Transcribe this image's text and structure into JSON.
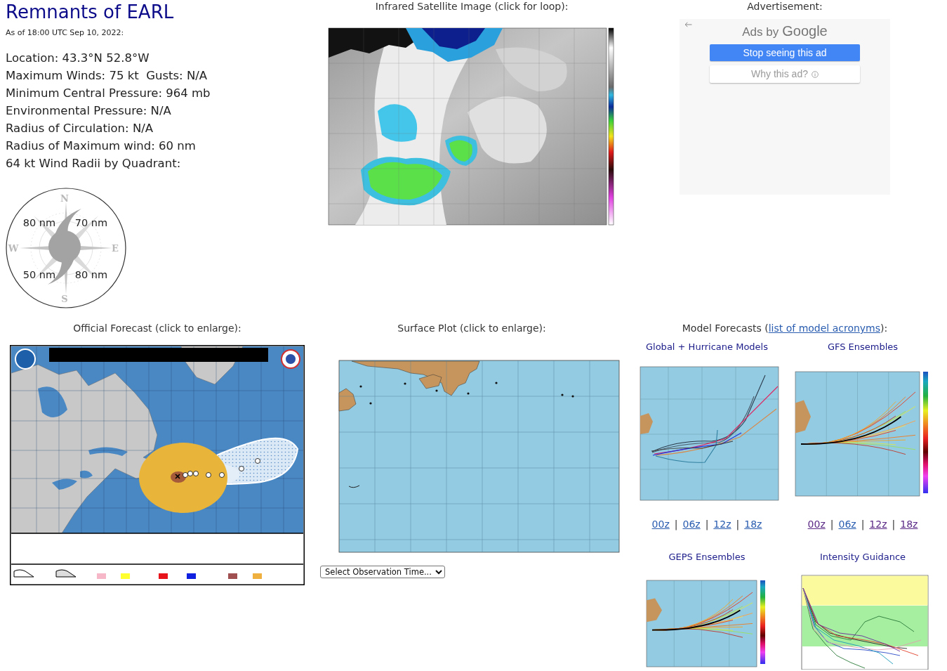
{
  "storm": {
    "title": "Remnants of EARL",
    "as_of": "As of 18:00 UTC Sep 10, 2022:",
    "details": [
      "Location: 43.3°N 52.8°W",
      "Maximum Winds: 75 kt  Gusts: N/A",
      "Minimum Central Pressure: 964 mb",
      "Environmental Pressure: N/A",
      "Radius of Circulation: N/A",
      "Radius of Maximum wind: 60 nm",
      "64 kt Wind Radii by Quadrant:"
    ]
  },
  "wind_radii": {
    "directions": [
      "N",
      "W",
      "E",
      "S"
    ],
    "quadrants": [
      "80 nm",
      "70 nm",
      "50 nm",
      "80 nm"
    ]
  },
  "satellite": {
    "caption": "Infrared Satellite Image (click for loop):"
  },
  "advertisement": {
    "caption": "Advertisement:",
    "label": "Ads by",
    "brand": "Google",
    "buttons": [
      {
        "label": "Stop seeing this ad",
        "kind": "primary"
      },
      {
        "label": "Why this ad?",
        "kind": "info"
      }
    ]
  },
  "official_forecast": {
    "caption": "Official Forecast (click to enlarge):"
  },
  "surface_plot": {
    "caption": "Surface Plot (click to enlarge):",
    "select": {
      "value": "Select Observation Time..."
    }
  },
  "model_forecasts": {
    "caption": "Model Forecasts (",
    "link": "list of model acronyms",
    "caption_end": "):",
    "separator": "|",
    "panels": [
      {
        "title": "Global + Hurricane Models",
        "kind": "tracks",
        "runs": [
          {
            "label": "00z",
            "visited": false
          },
          {
            "label": "06z",
            "visited": false
          },
          {
            "label": "12z",
            "visited": false
          },
          {
            "label": "18z",
            "visited": false
          }
        ]
      },
      {
        "title": "GFS Ensembles",
        "kind": "ensemble",
        "runs": [
          {
            "label": "00z",
            "visited": true
          },
          {
            "label": "06z",
            "visited": false
          },
          {
            "label": "12z",
            "visited": true
          },
          {
            "label": "18z",
            "visited": true
          }
        ]
      },
      {
        "title": "GEPS Ensembles",
        "kind": "ensemble"
      },
      {
        "title": "Intensity Guidance",
        "kind": "intensity"
      }
    ]
  }
}
